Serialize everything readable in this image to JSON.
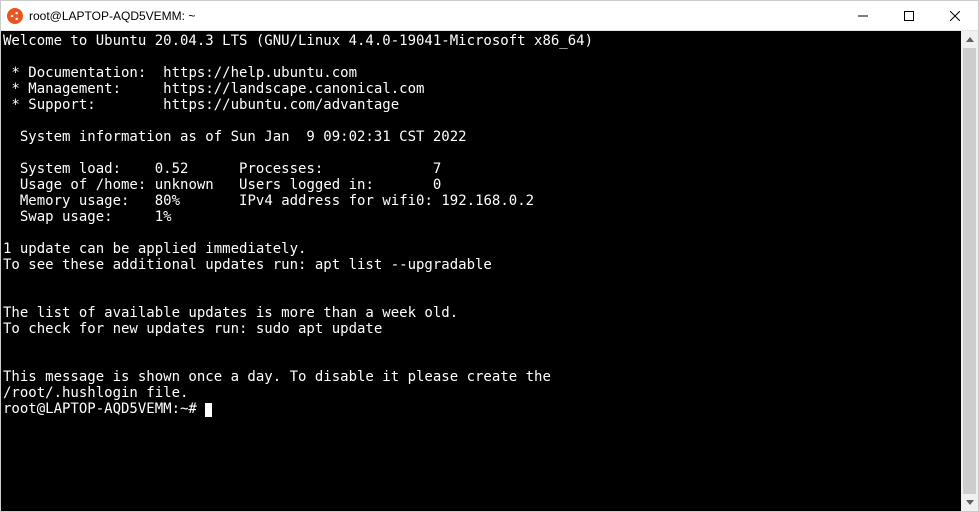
{
  "window": {
    "title": "root@LAPTOP-AQD5VEMM: ~"
  },
  "motd": {
    "welcome": "Welcome to Ubuntu 20.04.3 LTS (GNU/Linux 4.4.0-19041-Microsoft x86_64)",
    "links": {
      "documentation_label": " * Documentation:",
      "documentation_url": "https://help.ubuntu.com",
      "management_label": " * Management:",
      "management_url": "https://landscape.canonical.com",
      "support_label": " * Support:",
      "support_url": "https://ubuntu.com/advantage"
    },
    "sysinfo_header": "  System information as of Sun Jan  9 09:02:31 CST 2022",
    "sysinfo": {
      "system_load_label": "  System load:",
      "system_load_value": "0.52",
      "processes_label": "Processes:",
      "processes_value": "7",
      "usage_home_label": "  Usage of /home:",
      "usage_home_value": "unknown",
      "users_logged_label": "Users logged in:",
      "users_logged_value": "0",
      "memory_usage_label": "  Memory usage:",
      "memory_usage_value": "80%",
      "ipv4_label": "IPv4 address for wifi0:",
      "ipv4_value": "192.168.0.2",
      "swap_usage_label": "  Swap usage:",
      "swap_usage_value": "1%"
    },
    "updates_line1": "1 update can be applied immediately.",
    "updates_line2": "To see these additional updates run: apt list --upgradable",
    "stale_line1": "The list of available updates is more than a week old.",
    "stale_line2": "To check for new updates run: sudo apt update",
    "hush_line1": "This message is shown once a day. To disable it please create the",
    "hush_line2": "/root/.hushlogin file."
  },
  "prompt": {
    "text": "root@LAPTOP-AQD5VEMM:~#"
  }
}
